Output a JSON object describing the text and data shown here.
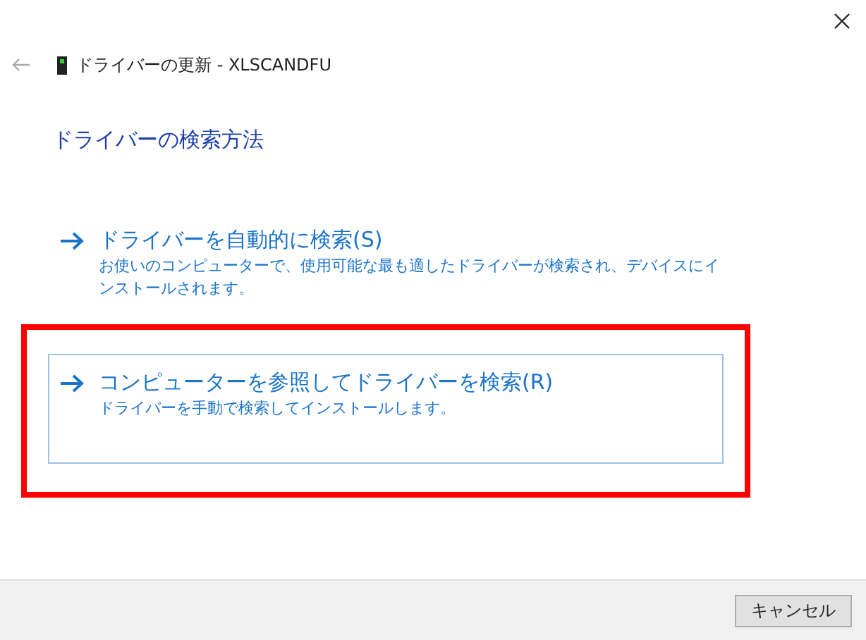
{
  "window": {
    "title": "ドライバーの更新 - XLSCANDFU"
  },
  "heading": "ドライバーの検索方法",
  "options": [
    {
      "label": "ドライバーを自動的に検索(S)",
      "description": "お使いのコンピューターで、使用可能な最も適したドライバーが検索され、デバイスにインストールされます。",
      "hovered": false,
      "highlighted": false
    },
    {
      "label": "コンピューターを参照してドライバーを検索(R)",
      "description": "ドライバーを手動で検索してインストールします。",
      "hovered": true,
      "highlighted": true
    }
  ],
  "buttons": [
    "キャンセル"
  ]
}
